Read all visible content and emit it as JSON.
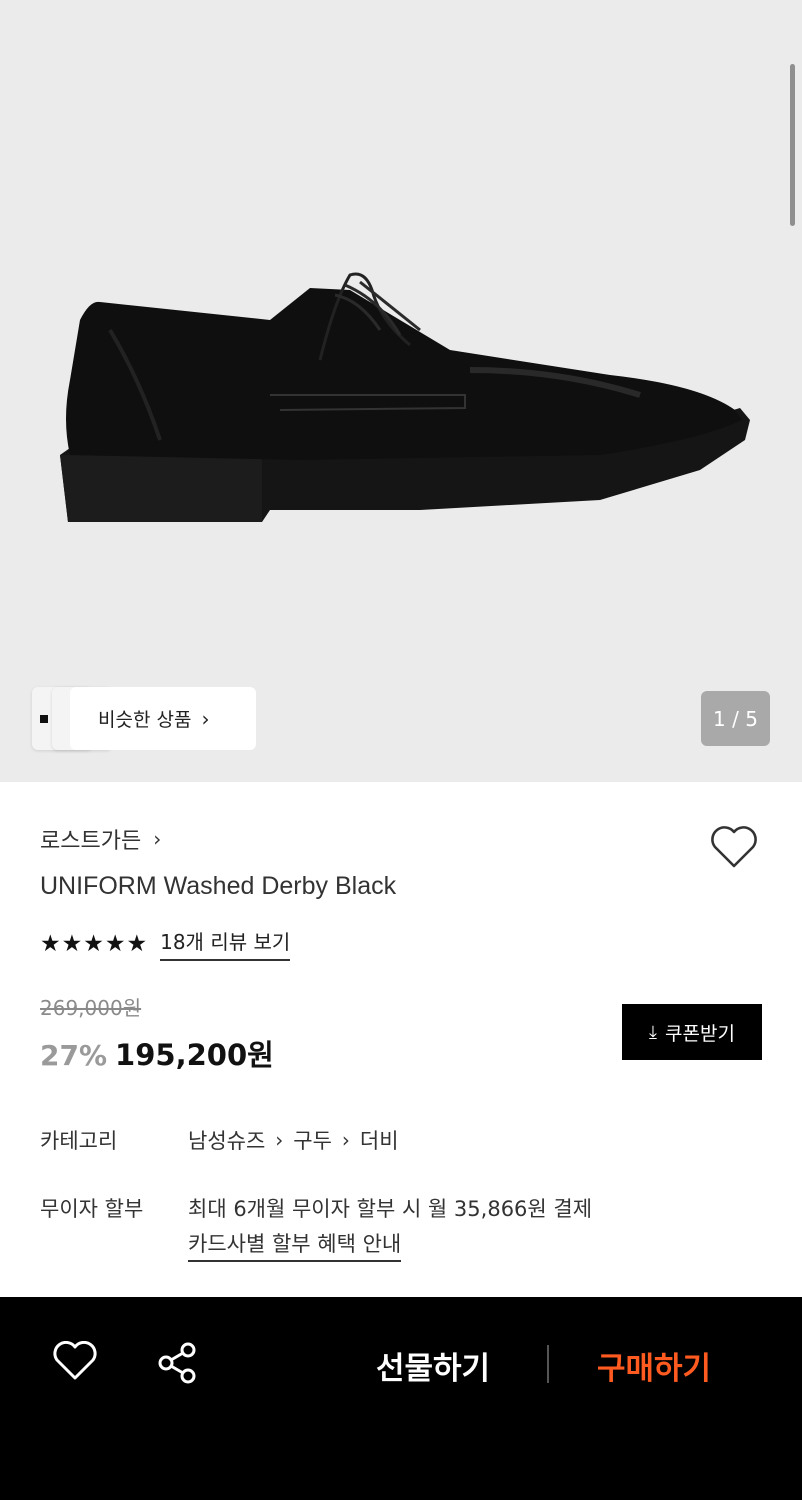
{
  "gallery": {
    "similar_label": "비슷한 상품",
    "pager": "1 / 5"
  },
  "product": {
    "brand": "로스트가든",
    "title": "UNIFORM Washed Derby Black",
    "rating_stars": "★★★★★",
    "rating_value": 5,
    "reviews_label": "18개 리뷰 보기",
    "original_price": "269,000원",
    "discount": "27%",
    "price": "195,200원",
    "coupon_label": "쿠폰받기"
  },
  "info": {
    "category_label": "카테고리",
    "category_path": [
      "남성슈즈",
      "구두",
      "더비"
    ],
    "installment_label": "무이자 할부",
    "installment_text": "최대 6개월 무이자 할부 시 월 35,866원 결제",
    "installment_link": "카드사별 할부 혜택 안내"
  },
  "bottom_bar": {
    "gift_label": "선물하기",
    "buy_label": "구매하기",
    "buy_color": "#ff5a1f"
  },
  "icons": {
    "wishlist": "heart-icon",
    "share": "share-icon",
    "download": "download-icon",
    "chevron": "chevron-right-icon"
  }
}
